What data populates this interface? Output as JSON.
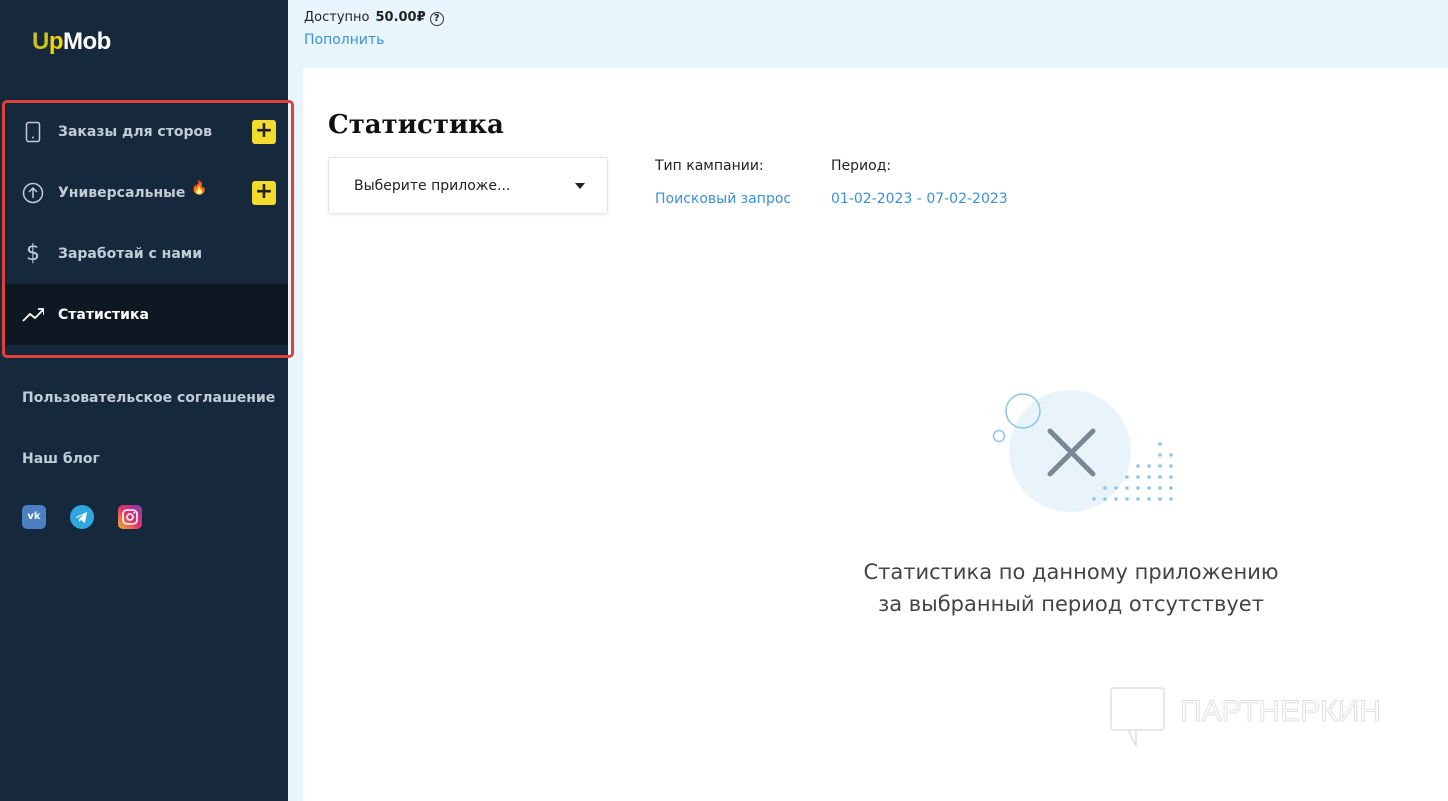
{
  "sidebar": {
    "logo": {
      "u": "U",
      "p": "p",
      "rest": "Mob"
    },
    "items": [
      {
        "label": "Заказы для сторов",
        "icon": "phone-icon",
        "plus": "+"
      },
      {
        "label": "Универсальные",
        "icon": "arrow-up-circle-icon",
        "badge": "🔥",
        "plus": "+"
      },
      {
        "label": "Заработай с нами",
        "icon": "dollar-icon"
      },
      {
        "label": "Статистика",
        "icon": "trending-up-icon",
        "active": true
      }
    ],
    "links": [
      "Пользовательское соглашение",
      "Наш блог"
    ],
    "social": [
      "vk-icon",
      "telegram-icon",
      "instagram-icon"
    ]
  },
  "header": {
    "available_label": "Доступно",
    "balance": "50.00₽",
    "help": "?",
    "topup": "Пополнить"
  },
  "main": {
    "title": "Статистика",
    "app_select": "Выберите приложе...",
    "campaign_type_label": "Тип кампании:",
    "campaign_type": "Поисковый запрос",
    "period_label": "Период:",
    "period": "01-02-2023 - 07-02-2023",
    "empty_line1": "Статистика по данному приложению",
    "empty_line2": "за выбранный период отсутствует"
  },
  "watermark": "ПАРТНЕРКИН",
  "colors": {
    "sidebar": "#15283c",
    "accent": "#f3dc2b",
    "link": "#3b90d6",
    "highlight": "#e0413a"
  }
}
